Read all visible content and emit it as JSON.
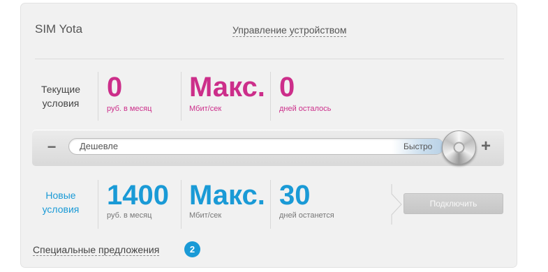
{
  "header": {
    "title": "SIM Yota",
    "manage_link": "Управление устройством"
  },
  "current": {
    "label_line1": "Текущие",
    "label_line2": "условия",
    "price_value": "0",
    "price_unit": "руб. в месяц",
    "speed_value": "Макс.",
    "speed_unit": "Мбит/сек",
    "days_value": "0",
    "days_unit": "дней осталось",
    "accent_color": "#cc2e8a"
  },
  "slider": {
    "minus_label": "−",
    "plus_label": "+",
    "left_label": "Дешевле",
    "right_label": "Быстро",
    "level": 1.0
  },
  "new": {
    "label_line1": "Новые",
    "label_line2": "условия",
    "price_value": "1400",
    "price_unit": "руб. в месяц",
    "speed_value": "Макс.",
    "speed_unit": "Мбит/сек",
    "days_value": "30",
    "days_unit": "дней останется",
    "accent_color": "#1a9ad6",
    "connect_button": "Подключить"
  },
  "offers": {
    "link_label": "Специальные предложения",
    "count": "2"
  }
}
